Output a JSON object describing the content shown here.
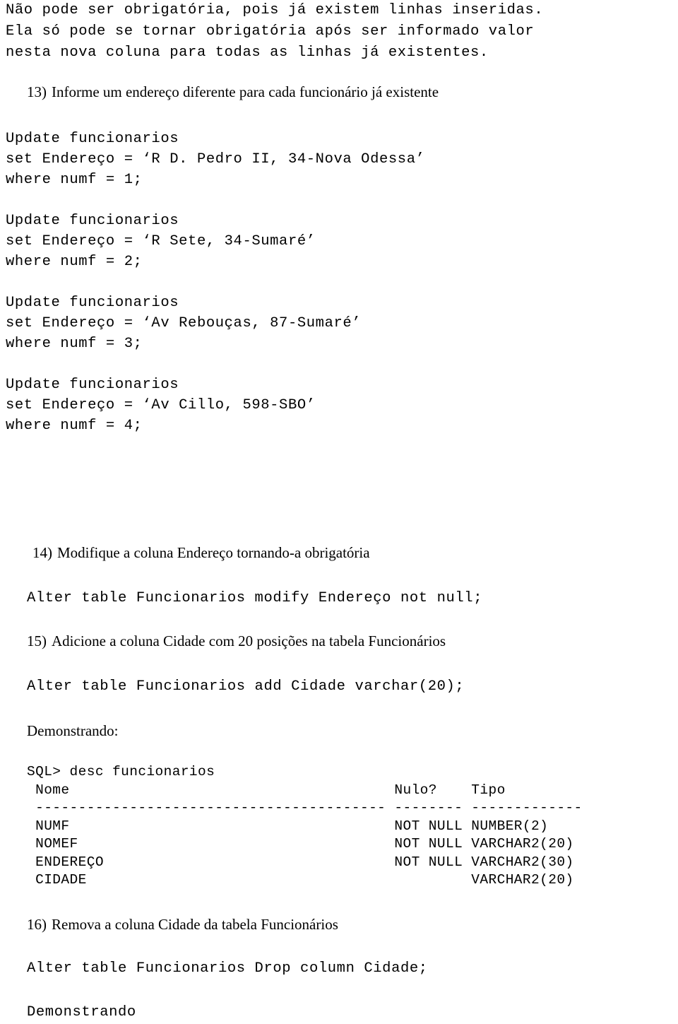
{
  "document": {
    "intro_lines": [
      "Não pode ser obrigatória, pois já existem linhas inseridas.",
      "Ela só pode se tornar obrigatória após ser informado valor",
      "nesta nova coluna para todas as linhas já existentes."
    ],
    "items": [
      {
        "marker": "13)",
        "title": "Informe um endereço diferente para cada funcionário já existente",
        "code": "Update funcionarios\nset Endereço = ‘R D. Pedro II, 34-Nova Odessa’\nwhere numf = 1;\n\nUpdate funcionarios\nset Endereço = ‘R Sete, 34-Sumaré’\nwhere numf = 2;\n\nUpdate funcionarios\nset Endereço = ‘Av Rebouças, 87-Sumaré’\nwhere numf = 3;\n\nUpdate funcionarios\nset Endereço = ‘Av Cillo, 598-SBO’\nwhere numf = 4;"
      },
      {
        "marker": "14)",
        "title": "Modifique a coluna Endereço tornando-a obrigatória",
        "code": "Alter table Funcionarios modify Endereço not null;"
      },
      {
        "marker": "15)",
        "title": "Adicione a coluna Cidade com 20 posições na tabela Funcionários",
        "code": "Alter table Funcionarios add Cidade varchar(20);"
      },
      {
        "marker": "16)",
        "title": "Remova a coluna Cidade da tabela Funcionários",
        "code": "Alter table Funcionarios Drop column Cidade;"
      }
    ],
    "demonstrating_label_1": "Demonstrando:",
    "demonstrating_label_2": "Demonstrando",
    "desc_output": "SQL> desc funcionarios\n Nome                                      Nulo?    Tipo\n ----------------------------------------- -------- -------------\n NUMF                                      NOT NULL NUMBER(2)\n NOMEF                                     NOT NULL VARCHAR2(20)\n ENDEREÇO                                  NOT NULL VARCHAR2(30)\n CIDADE                                             VARCHAR2(20)"
  }
}
